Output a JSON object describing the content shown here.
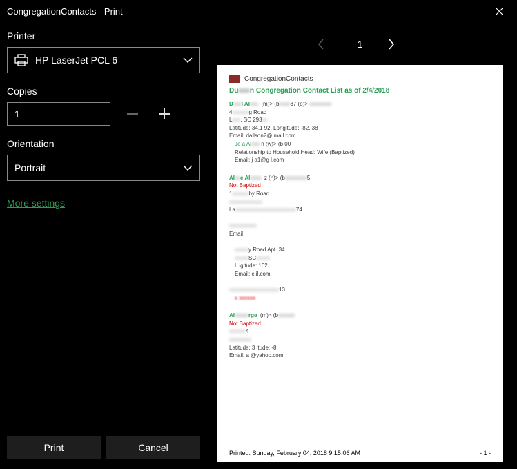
{
  "window": {
    "title": "CongregationContacts - Print"
  },
  "printer": {
    "label": "Printer",
    "selected": "HP LaserJet PCL 6"
  },
  "copies": {
    "label": "Copies",
    "value": "1"
  },
  "orientation": {
    "label": "Orientation",
    "selected": "Portrait"
  },
  "more_settings": "More settings",
  "buttons": {
    "print": "Print",
    "cancel": "Cancel"
  },
  "pager": {
    "page": "1"
  },
  "preview": {
    "app_title": "CongregationContacts",
    "list_title_prefix": "Du",
    "list_title_suffix": "n Congregation Contact List as of 2/4/2018",
    "people": [
      {
        "name_prefix": "D",
        "name_suffix": "l Al",
        "meta": "(m)> (b",
        "meta2": "37 (o)>",
        "addr1": "g Road",
        "addr2": ", SC 293",
        "latlon": "Latitude: 34.1       92, Longitude: -82.       38",
        "email": "Email: dallson2@        mail.com",
        "sub_name": "Je      a Al",
        "sub_meta": "n   (w)> (b        00",
        "rel": "Relationship to Household Head: Wife (Baptized)",
        "sub_email": "Email: j        a1@g      l.com"
      },
      {
        "name_prefix": "Al",
        "name_suffix": "e Al",
        "meta": "z   (h)> (b",
        "meta2": "5",
        "not_baptized": "Not Baptized",
        "addr1": "by Road",
        "lat": "La",
        "lat2": "74",
        "email": "Email",
        "addr3": "y Road Apt. 34",
        "addr4": "SC",
        "latlon2": "L                       igitude:             102",
        "email2": "Email: c                              il.com",
        "tail": "13"
      },
      {
        "name_prefix": "Al",
        "name_suffix": "rge",
        "meta": "(m)> (b",
        "not_baptized": "Not Baptized",
        "addr1": "4",
        "latlon": "Latitude: 3                 itude: -8",
        "email": "Email: a                    @yahoo.com"
      }
    ],
    "footer_left": "Printed: Sunday, February 04, 2018 9:15:06 AM",
    "footer_right": "- 1 -"
  }
}
